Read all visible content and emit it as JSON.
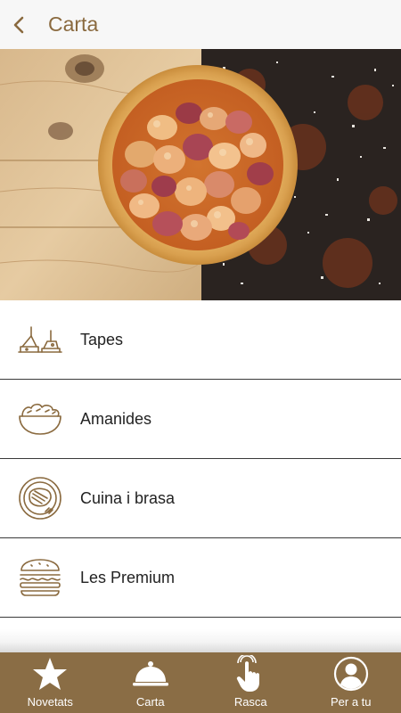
{
  "header": {
    "back_icon": "chevron-left-icon",
    "title": "Carta"
  },
  "hero": {
    "image": "grilled-octopus-dish-photo"
  },
  "menu": {
    "items": [
      {
        "label": "Tapes",
        "icon": "tapas-icon"
      },
      {
        "label": "Amanides",
        "icon": "salad-bowl-icon"
      },
      {
        "label": "Cuina i brasa",
        "icon": "grilled-steak-plate-icon"
      },
      {
        "label": "Les Premium",
        "icon": "burger-icon"
      }
    ]
  },
  "tabbar": {
    "tabs": [
      {
        "label": "Novetats",
        "icon": "star-icon"
      },
      {
        "label": "Carta",
        "icon": "cloche-icon"
      },
      {
        "label": "Rasca",
        "icon": "hand-tap-icon"
      },
      {
        "label": "Per a tu",
        "icon": "user-icon"
      }
    ]
  },
  "colors": {
    "accent_brown": "#8a6a3f",
    "tabbar_bg": "#8a6d45",
    "header_bg": "#f7f7f7"
  }
}
